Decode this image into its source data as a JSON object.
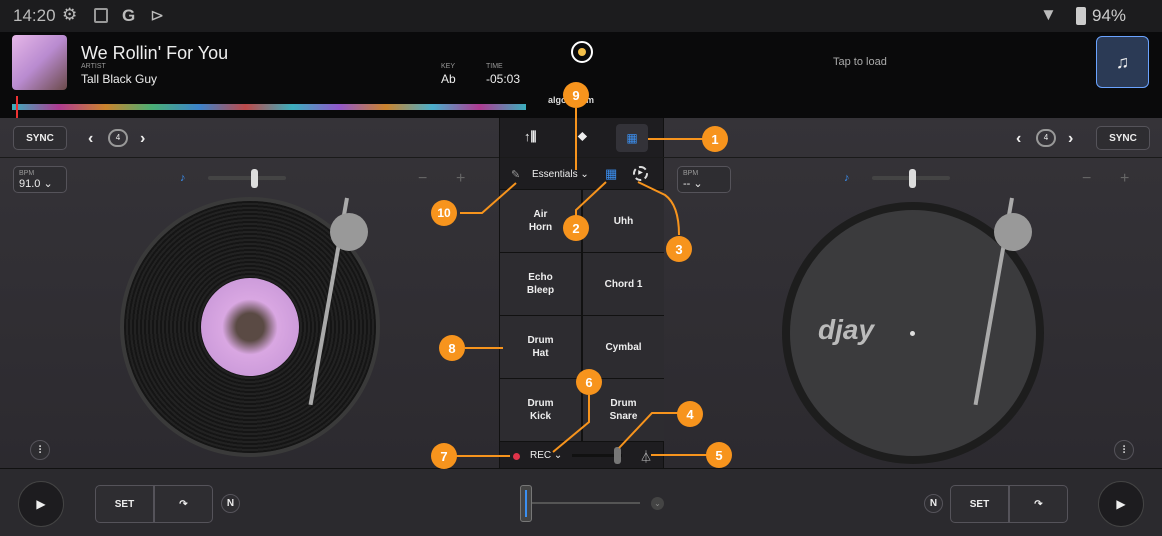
{
  "status": {
    "time": "14:20",
    "battery": "94%"
  },
  "track": {
    "title": "We Rollin' For You",
    "artist_label": "ARTIST",
    "artist": "Tall Black Guy",
    "key_label": "KEY",
    "key": "Ab",
    "time_label": "TIME",
    "time": "-05:03"
  },
  "right_deck": {
    "tap_to_load": "Tap to load",
    "bpm_label": "BPM",
    "bpm": "-- ⌄",
    "sync": "SYNC",
    "loop": "4",
    "logo": "djay"
  },
  "left_deck": {
    "sync": "SYNC",
    "loop": "4",
    "bpm_label": "BPM",
    "bpm": "91.0 ⌄"
  },
  "brand": "algoriddim",
  "sampler": {
    "bank": "Essentials ⌄",
    "pads": [
      "Air\nHorn",
      "Uhh",
      "Echo\nBleep",
      "Chord 1",
      "Drum\nHat",
      "Cymbal",
      "Drum\nKick",
      "Drum\nSnare"
    ],
    "rec": "REC ⌄"
  },
  "bottom": {
    "set": "SET",
    "n": "N"
  },
  "callouts": [
    "1",
    "2",
    "3",
    "4",
    "5",
    "6",
    "7",
    "8",
    "9",
    "10"
  ],
  "colors": {
    "accent": "#f7941d",
    "blue": "#3b8ff0",
    "rec": "#e0344a"
  }
}
